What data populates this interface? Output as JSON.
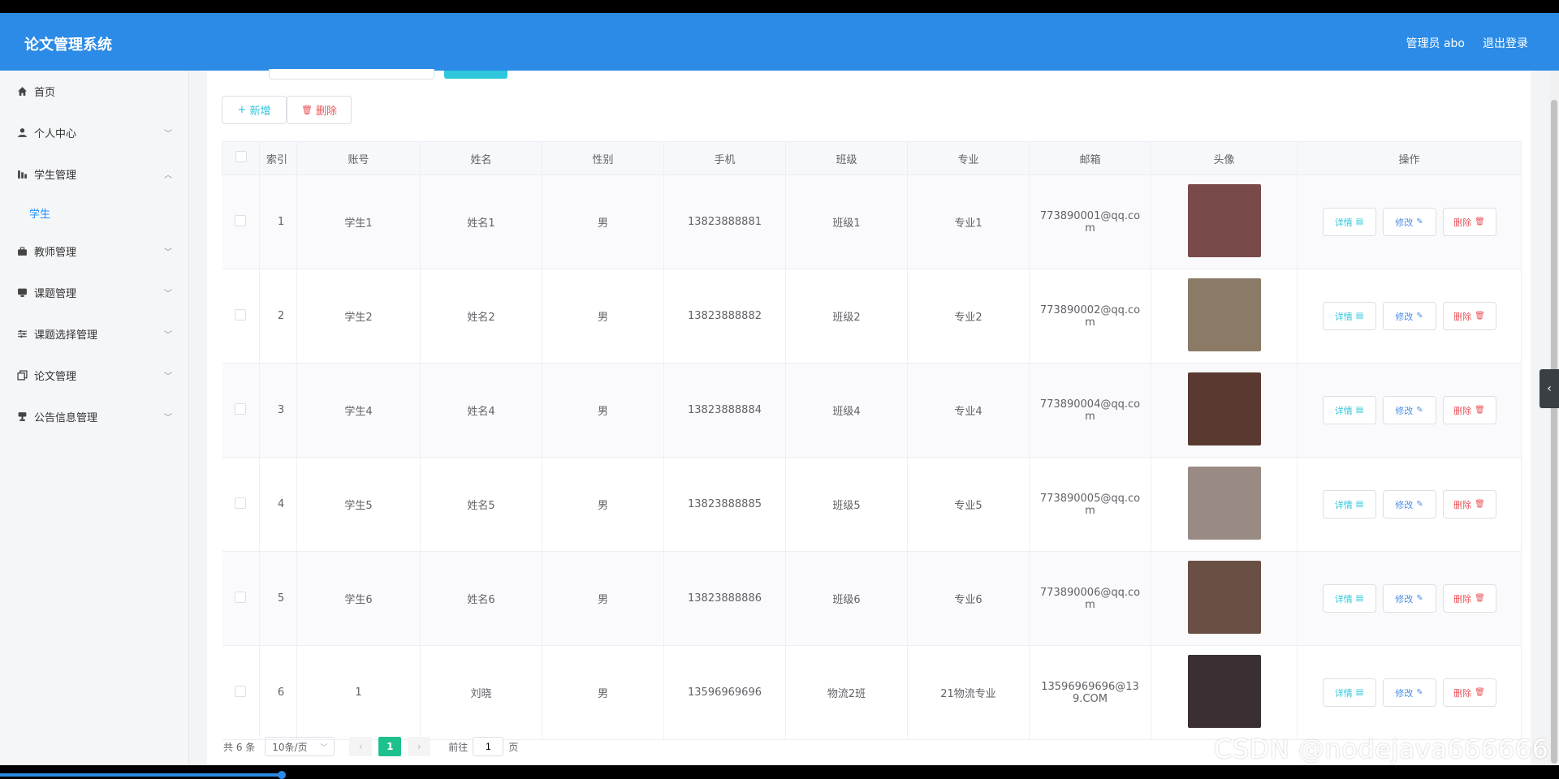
{
  "app": {
    "title": "论文管理系统"
  },
  "header": {
    "user": "管理员 abo",
    "logout": "退出登录"
  },
  "sidebar": {
    "items": [
      {
        "label": "首页",
        "icon": "home-icon"
      },
      {
        "label": "个人中心",
        "icon": "user-icon"
      },
      {
        "label": "学生管理",
        "icon": "chart-icon",
        "expanded": true,
        "children": [
          "学生"
        ]
      },
      {
        "label": "教师管理",
        "icon": "briefcase-icon"
      },
      {
        "label": "课题管理",
        "icon": "monitor-icon"
      },
      {
        "label": "课题选择管理",
        "icon": "sliders-icon"
      },
      {
        "label": "论文管理",
        "icon": "copy-icon"
      },
      {
        "label": "公告信息管理",
        "icon": "trophy-icon"
      }
    ]
  },
  "toolbar": {
    "add_label": "新增",
    "delete_label": "删除",
    "add_icon": "+",
    "delete_icon": "🗑"
  },
  "table": {
    "columns": [
      "索引",
      "账号",
      "姓名",
      "性别",
      "手机",
      "班级",
      "专业",
      "邮箱",
      "头像",
      "操作"
    ],
    "actions": {
      "view": "详情",
      "edit": "修改",
      "delete": "删除"
    },
    "rows": [
      {
        "index": "1",
        "account": "学生1",
        "name": "姓名1",
        "gender": "男",
        "phone": "13823888881",
        "class": "班级1",
        "major": "专业1",
        "email": "773890001@qq.com",
        "avatar_color": "#7a4a4a"
      },
      {
        "index": "2",
        "account": "学生2",
        "name": "姓名2",
        "gender": "男",
        "phone": "13823888882",
        "class": "班级2",
        "major": "专业2",
        "email": "773890002@qq.com",
        "avatar_color": "#8a7a66"
      },
      {
        "index": "3",
        "account": "学生4",
        "name": "姓名4",
        "gender": "男",
        "phone": "13823888884",
        "class": "班级4",
        "major": "专业4",
        "email": "773890004@qq.com",
        "avatar_color": "#5a3a30"
      },
      {
        "index": "4",
        "account": "学生5",
        "name": "姓名5",
        "gender": "男",
        "phone": "13823888885",
        "class": "班级5",
        "major": "专业5",
        "email": "773890005@qq.com",
        "avatar_color": "#9a8a84"
      },
      {
        "index": "5",
        "account": "学生6",
        "name": "姓名6",
        "gender": "男",
        "phone": "13823888886",
        "class": "班级6",
        "major": "专业6",
        "email": "773890006@qq.com",
        "avatar_color": "#6a5044"
      },
      {
        "index": "6",
        "account": "1",
        "name": "刘晓",
        "gender": "男",
        "phone": "13596969696",
        "class": "物流2班",
        "major": "21物流专业",
        "email": "13596969696@139.COM",
        "avatar_color": "#3a3034"
      }
    ]
  },
  "pagination": {
    "total": "共 6 条",
    "page_size": "10条/页",
    "current": "1",
    "goto_label": "前往",
    "goto_value": "1",
    "page_suffix": "页"
  },
  "watermark": "CSDN @nodejava666666"
}
